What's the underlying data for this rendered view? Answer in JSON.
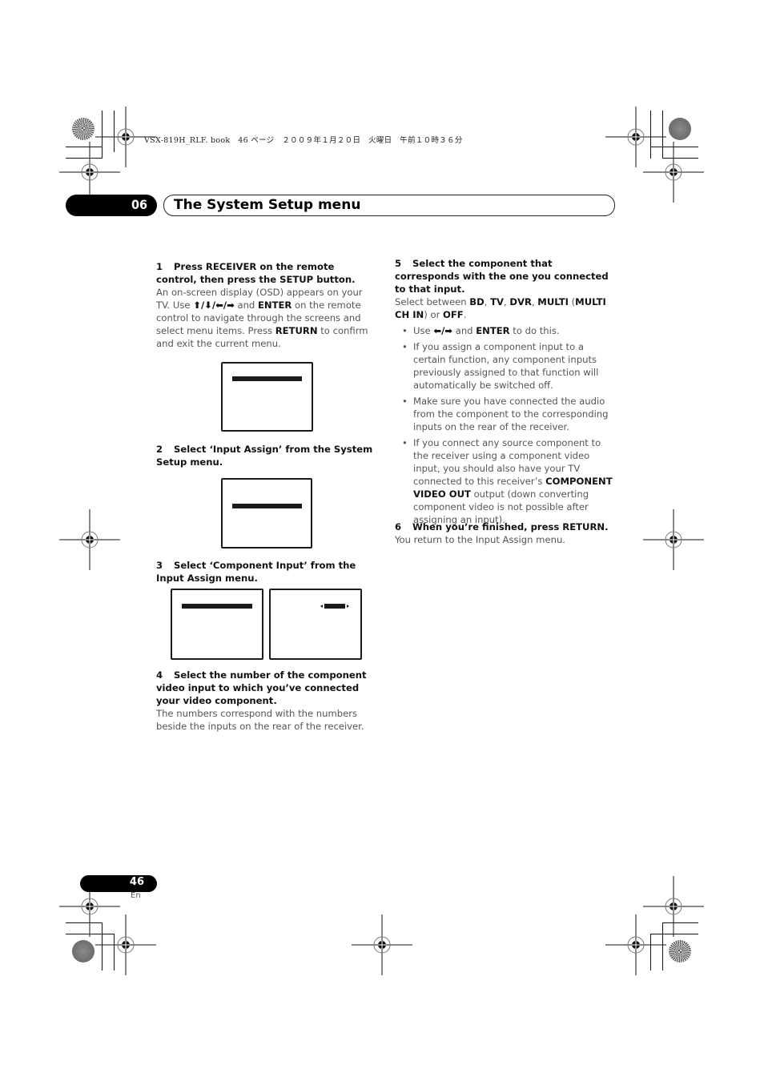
{
  "print_header": "VSX-819H_RLF. book　46 ページ　２００９年１月２０日　火曜日　午前１０時３６分",
  "chapter": {
    "number": "06",
    "title": "The System Setup menu"
  },
  "steps": [
    {
      "num": "1",
      "title": "Press RECEIVER on the remote control, then press the SETUP button.",
      "body_parts": {
        "a": "An on-screen display (OSD) appears on your TV. Use ",
        "arrows": "⬆/⬇/⬅/➡",
        "b": " and ",
        "enter": "ENTER",
        "c": " on the remote control to navigate through the screens and select menu items. Press ",
        "return": "RETURN",
        "d": " to confirm and exit the current menu."
      }
    },
    {
      "num": "2",
      "title": "Select ‘Input Assign’ from the System Setup menu."
    },
    {
      "num": "3",
      "title": "Select ‘Component Input’ from the Input Assign menu."
    },
    {
      "num": "4",
      "title": "Select the number of the component video input to which you’ve connected your video component.",
      "body": "The numbers correspond with the numbers beside the inputs on the rear of the receiver."
    },
    {
      "num": "5",
      "title": "Select the component that corresponds with the one you connected to that input.",
      "body_parts": {
        "a": "Select between ",
        "bd": "BD",
        "sep1": ", ",
        "tv": "TV",
        "sep2": ", ",
        "dvr": "DVR",
        "sep3": ", ",
        "multi": "MULTI",
        "paren_open": " (",
        "multi_ch_in": "MULTI CH IN",
        "paren_close": ") or ",
        "off": "OFF",
        "end": "."
      },
      "bullets": [
        {
          "a": "Use ",
          "arrows": "⬅/➡",
          "b": " and ",
          "enter": "ENTER",
          "c": " to do this."
        },
        {
          "text": "If you assign a component input to a certain function, any component inputs previously assigned to that function will automatically be switched off."
        },
        {
          "text": "Make sure you have connected the audio from the component to the corresponding inputs on the rear of the receiver."
        },
        {
          "a": "If you connect any source component to the receiver using a component video input, you should also have your TV connected to this receiver’s ",
          "bold": "COMPONENT VIDEO OUT",
          "c": " output (down converting component video is not possible after assigning an input)."
        }
      ]
    },
    {
      "num": "6",
      "title": "When you’re finished, press RETURN.",
      "body": "You return to the Input Assign menu."
    }
  ],
  "footer": {
    "page_number": "46",
    "language": "En"
  },
  "icons": {
    "registration_mark": "crosshair-circle",
    "corner_disc_spiral": "spiral-disc",
    "corner_disc_grey": "grey-disc"
  }
}
